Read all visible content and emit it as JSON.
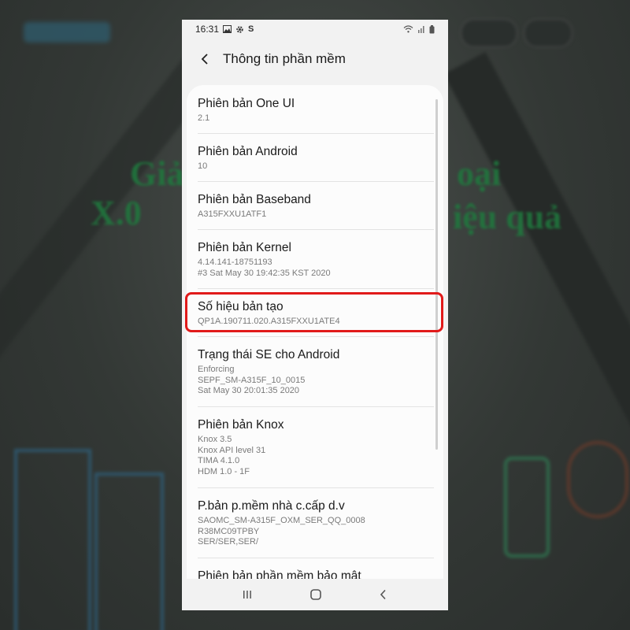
{
  "status_bar": {
    "time": "16:31",
    "left_icons": [
      "image-icon",
      "gear-icon",
      "s-icon"
    ],
    "right_icons": [
      "wifi-icon",
      "signal-icon",
      "battery-icon"
    ]
  },
  "header": {
    "back_icon": "back-arrow-icon",
    "title": "Thông tin phần mềm"
  },
  "items": [
    {
      "title": "Phiên bản One UI",
      "lines": [
        "2.1"
      ]
    },
    {
      "title": "Phiên bản Android",
      "lines": [
        "10"
      ]
    },
    {
      "title": "Phiên bản Baseband",
      "lines": [
        "A315FXXU1ATF1"
      ]
    },
    {
      "title": "Phiên bản Kernel",
      "lines": [
        "4.14.141-18751193",
        "#3 Sat May 30 19:42:35 KST 2020"
      ]
    },
    {
      "title": "Số hiệu bản tạo",
      "lines": [
        "QP1A.190711.020.A315FXXU1ATE4"
      ]
    },
    {
      "title": "Trạng thái SE cho Android",
      "lines": [
        "Enforcing",
        "SEPF_SM-A315F_10_0015",
        "Sat May 30 20:01:35 2020"
      ]
    },
    {
      "title": "Phiên bản Knox",
      "lines": [
        "Knox 3.5",
        "Knox API level 31",
        "TIMA 4.1.0",
        "HDM 1.0 - 1F"
      ]
    },
    {
      "title": "P.bản p.mềm nhà c.cấp d.v",
      "lines": [
        "SAOMC_SM-A315F_OXM_SER_QQ_0008",
        "R38MC09TPBY",
        "SER/SER,SER/"
      ]
    },
    {
      "title": "Phiên bản phần mềm bảo mật",
      "lines": []
    }
  ],
  "highlighted_item": "Số hiệu bản tạo",
  "nav_bar": {
    "icons": [
      "recents-icon",
      "home-icon",
      "back-icon"
    ]
  },
  "colors": {
    "highlight": "#e11a1a",
    "background": "#f2f2f2",
    "card": "#fcfcfc"
  }
}
